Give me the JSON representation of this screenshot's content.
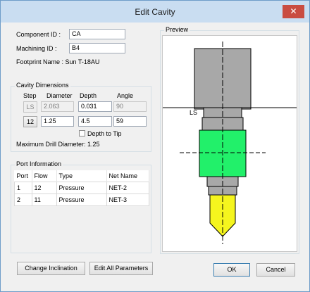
{
  "window": {
    "title": "Edit Cavity",
    "close_label": "✕"
  },
  "form": {
    "component_id_label": "Component ID :",
    "component_id_value": "CA",
    "machining_id_label": "Machining ID :",
    "machining_id_value": "B4",
    "footprint_label": "Footprint Name : Sun T-18AU"
  },
  "cavity": {
    "group_label": "Cavity Dimensions",
    "headers": {
      "step": "Step",
      "diameter": "Diameter",
      "depth": "Depth",
      "angle": "Angle"
    },
    "rows": [
      {
        "step": "LS",
        "diameter": "2.063",
        "depth": "0.031",
        "angle": "90"
      },
      {
        "step": "12",
        "diameter": "1.25",
        "depth": "4.5",
        "angle": "59"
      }
    ],
    "depth_to_tip_label": "Depth to Tip",
    "depth_to_tip_checked": false,
    "max_drill_label": "Maximum Drill Diameter: 1.25"
  },
  "ports": {
    "group_label": "Port Information",
    "columns": [
      "Port",
      "Flow",
      "Type",
      "Net Name"
    ],
    "rows": [
      [
        "1",
        "12",
        "Pressure",
        "NET-2"
      ],
      [
        "2",
        "11",
        "Pressure",
        "NET-3"
      ]
    ]
  },
  "preview": {
    "group_label": "Preview",
    "ls_label": "LS",
    "colors": {
      "gray": "#a8a8a8",
      "green": "#22f06a",
      "yellow": "#f5f51e"
    }
  },
  "buttons": {
    "change_inclination": "Change Inclination",
    "edit_all_parameters": "Edit All Parameters",
    "ok": "OK",
    "cancel": "Cancel"
  }
}
